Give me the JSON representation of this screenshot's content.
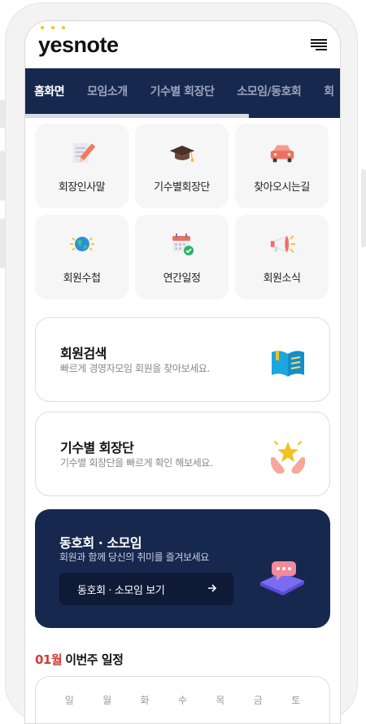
{
  "brand": {
    "logo_text": "yesnote"
  },
  "header": {
    "menu_icon": "hamburger-menu-icon"
  },
  "tabs": [
    {
      "label": "홈화면",
      "active": true
    },
    {
      "label": "모임소개",
      "active": false
    },
    {
      "label": "기수별 회장단",
      "active": false
    },
    {
      "label": "소모임/동호회",
      "active": false
    },
    {
      "label": "회",
      "active": false
    }
  ],
  "quick_menu": [
    {
      "label": "회장인사말",
      "icon": "notepad-pencil-icon"
    },
    {
      "label": "기수별회장단",
      "icon": "graduation-cap-icon"
    },
    {
      "label": "찾아오시는길",
      "icon": "car-icon"
    },
    {
      "label": "회원수첩",
      "icon": "globe-icon"
    },
    {
      "label": "연간일정",
      "icon": "calendar-check-icon"
    },
    {
      "label": "회원소식",
      "icon": "megaphone-icon"
    }
  ],
  "cards": {
    "member_search": {
      "title": "회원검색",
      "subtitle": "빠르게 경영자모임 회원을 찾아보세요.",
      "icon": "open-book-icon"
    },
    "presidents": {
      "title": "기수별 회장단",
      "subtitle": "기수별 회장단을 빠르게 확인 해보세요.",
      "icon": "star-hands-icon"
    }
  },
  "club_banner": {
    "title": "동호회 · 소모임",
    "subtitle": "회원과 함께 당신의 취미를 즐겨보세요",
    "button_label": "동호회 · 소모임 보기",
    "button_icon": "arrow-right-icon",
    "icon": "chat-bubble-icon"
  },
  "schedule": {
    "month": "01월",
    "title": "이번주 일정",
    "weekdays": [
      "일",
      "월",
      "화",
      "수",
      "목",
      "금",
      "토"
    ]
  },
  "colors": {
    "navy": "#17284F",
    "accent_red": "#D33B3B",
    "logo_dot": "#F4C21E"
  }
}
